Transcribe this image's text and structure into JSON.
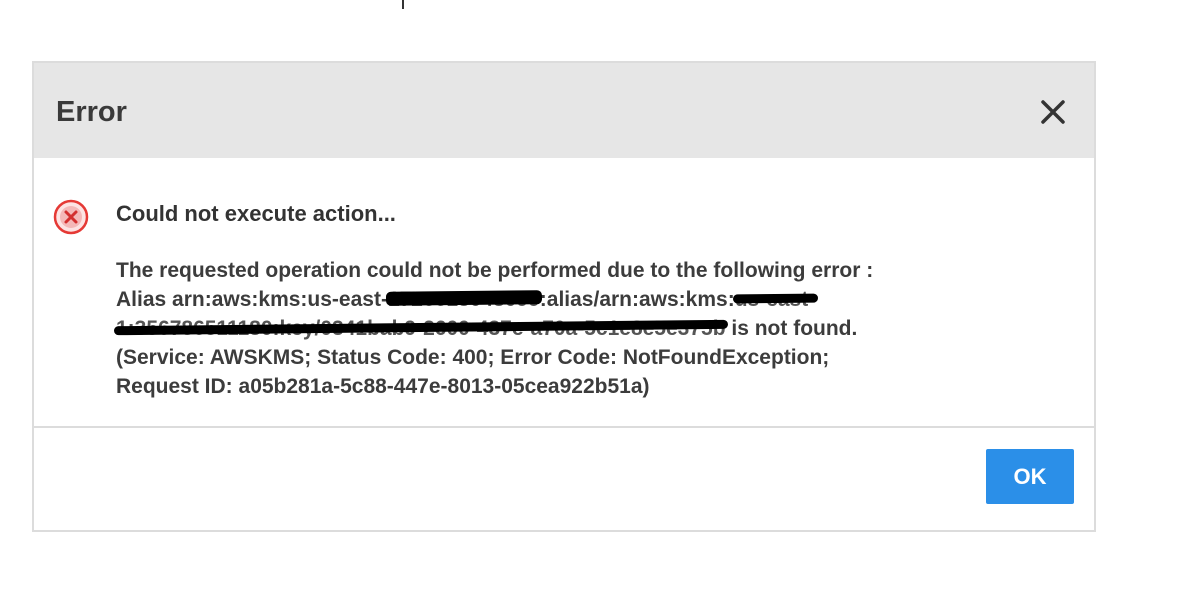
{
  "dialog": {
    "title": "Error",
    "close_label": "×",
    "summary": "Could not execute action...",
    "details": {
      "line1": "The requested operation could not be performed due to the following error :",
      "line2_a": "Alias arn:aws:kms:us-east-",
      "line2_redacted": "1726618048099",
      "line2_b": ":alias/arn:aws:kms:",
      "line2_redacted2": "us-east-",
      "line3_redacted": "1:356786511180:key/0341bab9-2600-437e-a70a-5c1e8e5e375b",
      "line3_b": " is not found.",
      "line4": "(Service: AWSKMS; Status Code: 400; Error Code: NotFoundException;",
      "line5": "Request ID: a05b281a-5c88-447e-8013-05cea922b51a)"
    },
    "ok_label": "OK"
  },
  "icons": {
    "error": "error-circle-icon",
    "close": "close-icon"
  },
  "colors": {
    "header_bg": "#e6e6e6",
    "ok_button": "#2b8fe8",
    "error_icon": "#e53935"
  }
}
